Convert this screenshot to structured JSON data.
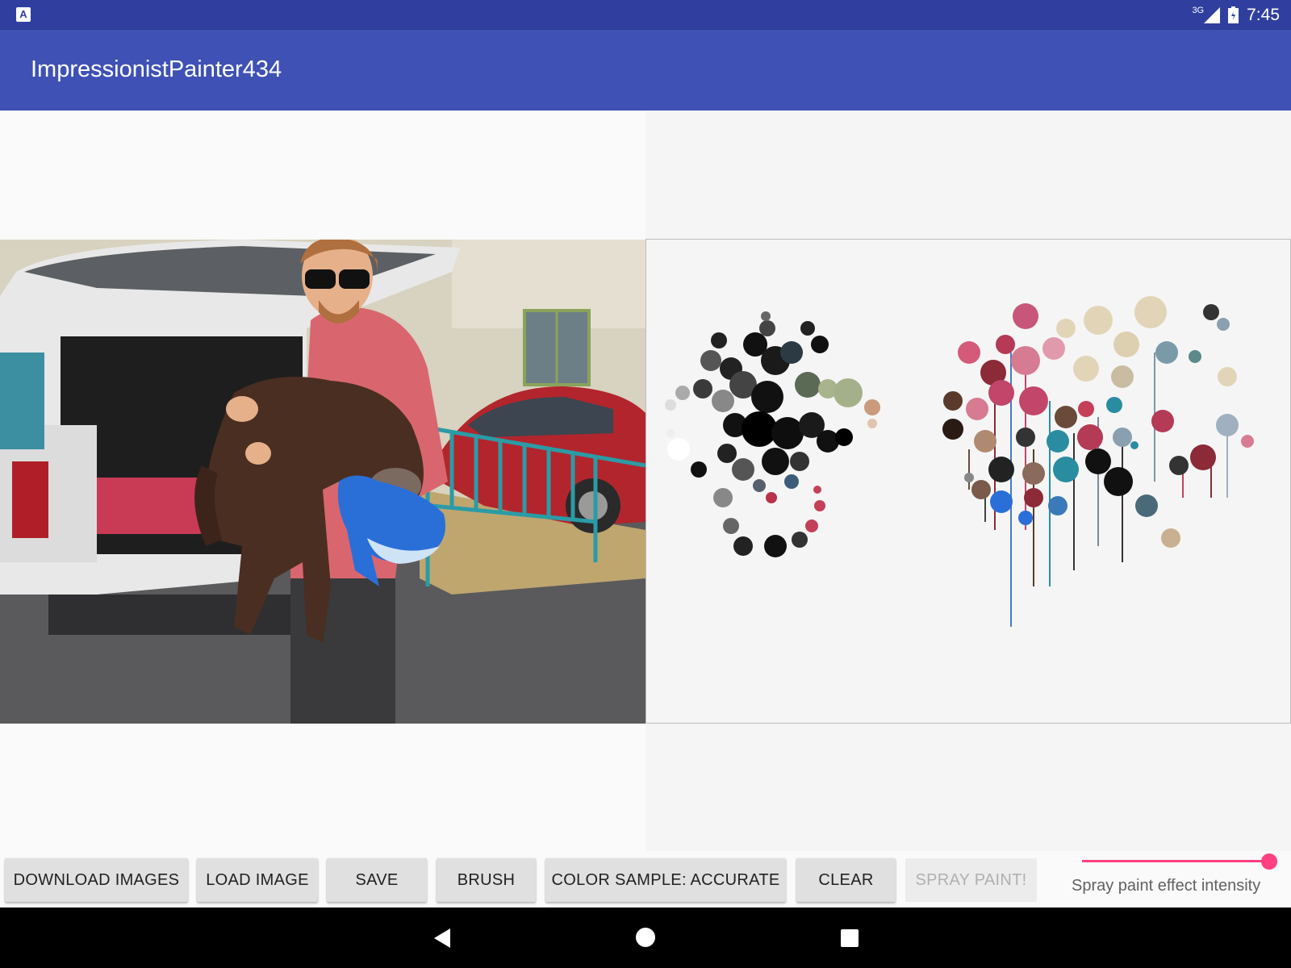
{
  "status_bar": {
    "app_icon": "A",
    "network": "3G",
    "time": "7:45",
    "icons": [
      "app-notification-icon",
      "signal-icon",
      "battery-icon"
    ]
  },
  "app_bar": {
    "title": "ImpressionistPainter434"
  },
  "toolbar": {
    "buttons": [
      {
        "label": "DOWNLOAD IMAGES",
        "enabled": true
      },
      {
        "label": "LOAD IMAGE",
        "enabled": true
      },
      {
        "label": "SAVE",
        "enabled": true
      },
      {
        "label": "BRUSH",
        "enabled": true
      },
      {
        "label": "COLOR SAMPLE: ACCURATE",
        "enabled": true
      },
      {
        "label": "CLEAR",
        "enabled": true
      },
      {
        "label": "SPRAY PAINT!",
        "enabled": false
      }
    ],
    "slider": {
      "label": "Spray paint effect intensity",
      "value_fraction": 1.0
    }
  },
  "nav_bar": {
    "icons": [
      "back-icon",
      "home-icon",
      "recents-icon"
    ]
  },
  "colors": {
    "status_bar": "#303f9f",
    "app_bar": "#3f51b5",
    "accent": "#ff4081"
  }
}
